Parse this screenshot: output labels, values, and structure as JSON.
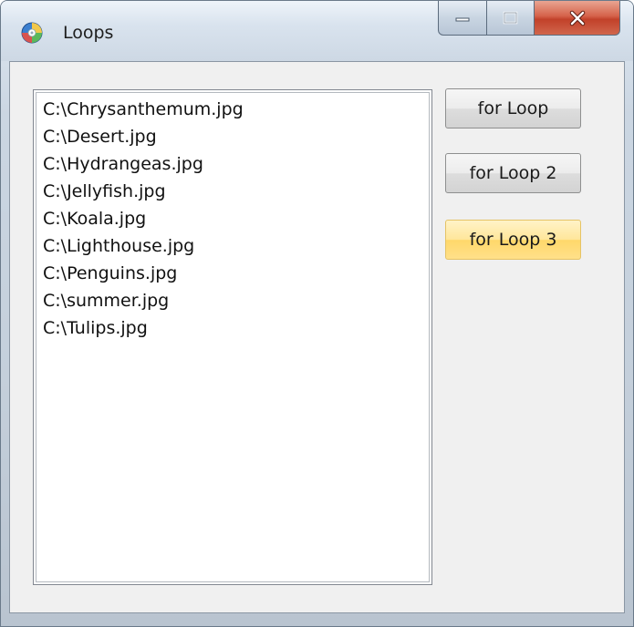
{
  "window": {
    "title": "Loops"
  },
  "listbox": {
    "items": [
      "C:\\Chrysanthemum.jpg",
      "C:\\Desert.jpg",
      "C:\\Hydrangeas.jpg",
      "C:\\Jellyfish.jpg",
      "C:\\Koala.jpg",
      "C:\\Lighthouse.jpg",
      "C:\\Penguins.jpg",
      "C:\\summer.jpg",
      "C:\\Tulips.jpg"
    ]
  },
  "buttons": {
    "for_loop": "for Loop",
    "for_loop_2": "for Loop 2",
    "for_loop_3": "for Loop 3"
  },
  "icons": {
    "app": "app-icon",
    "minimize": "minimize-icon",
    "maximize": "maximize-icon",
    "close": "close-icon"
  },
  "colors": {
    "hover_button": "#ffe08a",
    "close_button": "#c2412a"
  }
}
